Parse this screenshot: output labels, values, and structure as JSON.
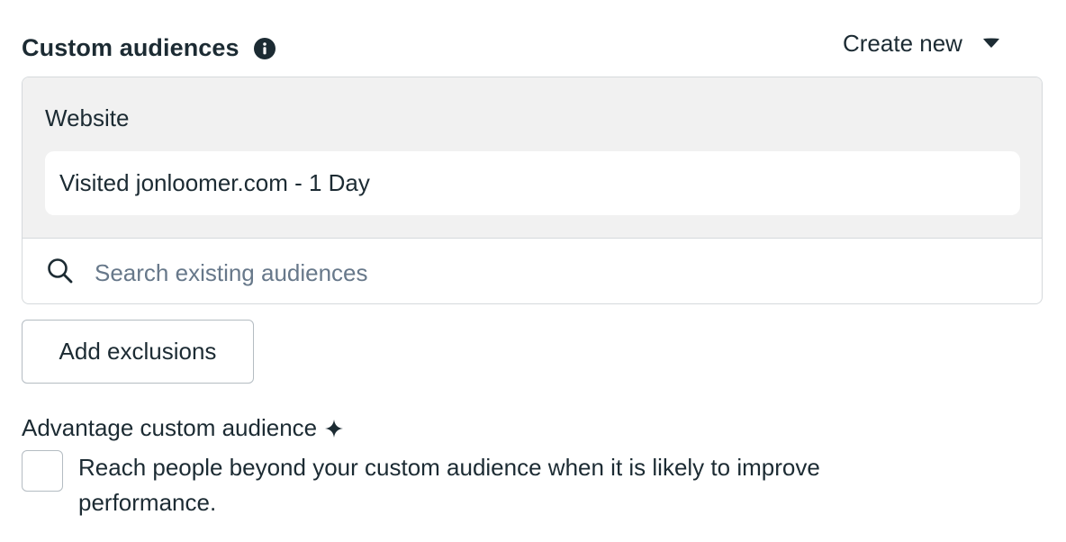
{
  "header": {
    "title": "Custom audiences",
    "info_icon": "info-icon",
    "create_new_label": "Create new",
    "create_new_icon": "caret-down-icon"
  },
  "audiences": {
    "category_label": "Website",
    "selected": [
      "Visited jonloomer.com - 1 Day"
    ],
    "search": {
      "icon": "search-icon",
      "placeholder": "Search existing audiences",
      "value": ""
    }
  },
  "exclusions": {
    "button_label": "Add exclusions"
  },
  "advantage": {
    "label": "Advantage custom audience",
    "icon": "sparkle-icon",
    "checked": false,
    "description": "Reach people beyond your custom audience when it is likely to improve performance."
  },
  "colors": {
    "text": "#1c2b33",
    "muted": "#67788a",
    "panel_bg": "#f1f1f1",
    "border": "#d5d9dc"
  }
}
